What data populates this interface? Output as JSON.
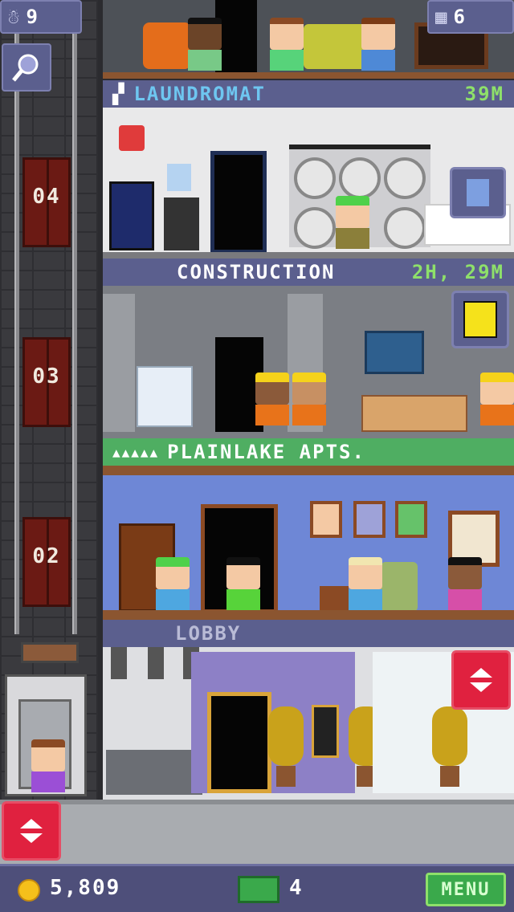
{
  "hud": {
    "population": "9",
    "floors": "6",
    "coins": "5,809",
    "bux": "4",
    "menu_label": "MENU"
  },
  "icons": {
    "population": "person-icon",
    "floors": "building-icon",
    "search": "magnifier-icon",
    "coin": "coin-icon",
    "bux": "banknote-icon",
    "elevator_control": "up-down-arrows-icon"
  },
  "shaft": {
    "floor_numbers": [
      "04",
      "03",
      "02"
    ]
  },
  "floors": [
    {
      "name": "LAUNDROMAT",
      "status": "39M",
      "accent": "#6ec6f0"
    },
    {
      "name": "CONSTRUCTION",
      "status": "2H, 29M",
      "accent": "#f1eadf"
    },
    {
      "name": "PLAINLAKE APTS.",
      "status": "",
      "residents_marker": "▲▲▲▲▲",
      "accent": "#f1eadf"
    },
    {
      "name": "LOBBY",
      "status": "",
      "accent": "#b9bbd6"
    }
  ],
  "colors": {
    "banner_bg": "#5b5f8e",
    "apartment_banner_bg": "#4fae62",
    "status_green": "#8ee06a",
    "red_button": "#e0213f",
    "menu_button": "#3aa94b"
  }
}
